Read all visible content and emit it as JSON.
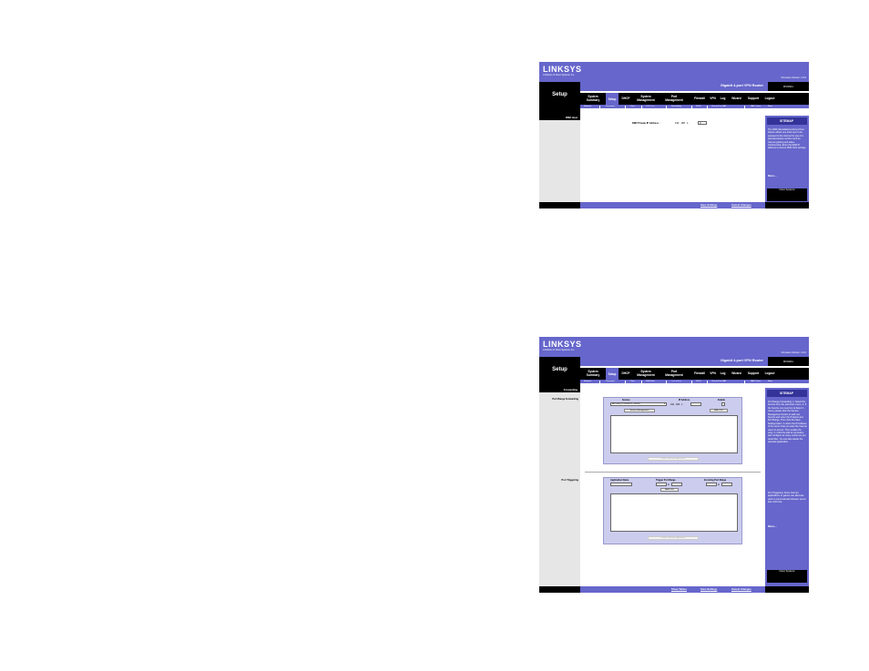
{
  "brand": {
    "logo": "LINKSYS",
    "logo_sub": "A Division of Cisco Systems, Inc.",
    "firmware": "Firmware Version: 1.0.0"
  },
  "product": {
    "name": "Gigabit 4-port VPN Router",
    "model": "RV0041"
  },
  "section": "Setup",
  "tabs": [
    "System Summary",
    "Setup",
    "DHCP",
    "System Management",
    "Port Management",
    "Firewall",
    "VPN",
    "Log",
    "Wizard",
    "Support",
    "Logout"
  ],
  "subtabs": [
    "Network",
    "Password",
    "Time",
    "DMZ Host",
    "Forwarding",
    "UPnP",
    "One-to-One NAT",
    "MAC Clone",
    "More"
  ],
  "dmz": {
    "side_header": "DMZ Host",
    "label": "DMZ Private IP Address :",
    "ip_prefix": "192 . 168 . 1 .",
    "ip_last": "0"
  },
  "sitemap1": {
    "title": "SITEMAP",
    "text": "The DMZ (Demilitarized Zone) Host feature allows one local user to be exposed to the Internet for use of a special-purpose service such as Internet gaming and video-conferencing. Enter the DMZ IP address to access DMZ Host settings.",
    "more": "More..."
  },
  "footer1": {
    "save": "Save Settings",
    "cancel": "Cancel Changes"
  },
  "forwarding": {
    "side_header": "Forwarding",
    "port_range_label": "Port Range Forwarding",
    "col_service": "Service",
    "col_ip": "IP Address",
    "col_enable": "Enable",
    "service_value": "All Traffic [TCP&UDP/1~65535]",
    "ip_prefix": "192 . 168 . 1 .",
    "service_mgmt_btn": "Service Management",
    "add_list_btn": "Add to list",
    "delete_btn": "Delete selected application",
    "port_trigger_label": "Port Triggering",
    "col_app": "Application Name",
    "col_trigger": "Trigger Port Range",
    "col_incoming": "Incoming Port Range",
    "to": "to",
    "add_list_btn2": "Add to list",
    "delete_btn2": "Delete selected application"
  },
  "sitemap2": {
    "title": "SITEMAP",
    "text": "Port Range Forwarding: 1. Select the Service from the pull-down menu. 2. If the Service you need is not listed in menu, please click the Service Management button to add new Service and enter the Protocol and Port Range. Then click the Save Setting button. 3. Enter the IP Address of the server that you want the Internet users to access. Then enable the entry. 4. Click the Add to List button, and configure as many entries as you would like. You can also delete the selected application.",
    "text2": "Port Triggering: Some Internet applications or games use alternate ports to communicate between server and LAN host.",
    "more": "More..."
  },
  "footer2": {
    "show_tables": "Show Tables",
    "save": "Save Settings",
    "cancel": "Cancel Changes"
  },
  "cisco_label": "Cisco Systems"
}
